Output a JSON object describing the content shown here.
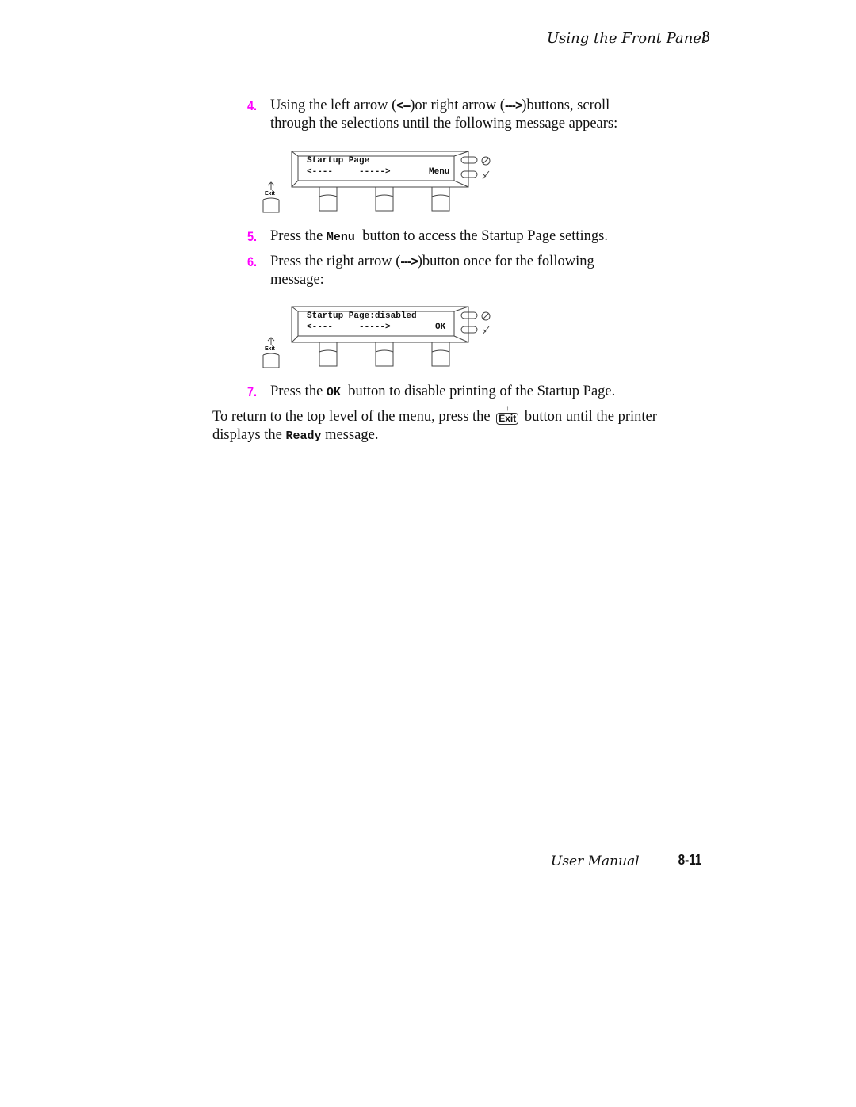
{
  "header": {
    "section_title": "Using the Front Panel",
    "chapter_number": "8"
  },
  "steps": [
    {
      "number": "4.",
      "parts": {
        "a": "Using the left arrow (",
        "left_arrow": "<--",
        "b": ")or right arrow (",
        "right_arrow": "--->",
        "c": ")buttons, scroll",
        "line2": "through the selections until the following message appears:"
      }
    },
    {
      "number": "5.",
      "parts": {
        "a": "Press the ",
        "key": "Menu",
        "b": "  button to access the Startup Page settings."
      }
    },
    {
      "number": "6.",
      "parts": {
        "a": "Press the right arrow (",
        "right_arrow": "--->",
        "b": ")button once for the following",
        "line2": "message:"
      }
    },
    {
      "number": "7.",
      "parts": {
        "a": "Press the ",
        "key": "OK",
        "b": "  button to disable printing of the Startup Page."
      }
    }
  ],
  "panels": [
    {
      "line1": "Startup Page",
      "left_arrow": "<----",
      "right_arrow": "----->",
      "softkey": "Menu",
      "exit_label": "Exit",
      "icons": [
        "online-icon",
        "cancel-icon"
      ]
    },
    {
      "line1": "Startup Page:disabled",
      "left_arrow": "<----",
      "right_arrow": "----->",
      "softkey": "OK",
      "exit_label": "Exit",
      "icons": [
        "online-icon",
        "cancel-icon"
      ]
    }
  ],
  "closing": {
    "a": "To return to the top level of the menu, press the ",
    "exit_key": "Exit",
    "b": " button until the printer",
    "c": "displays the ",
    "ready": "Ready",
    "d": " message."
  },
  "footer": {
    "manual_title": "User Manual",
    "page_number": "8-11"
  },
  "colors": {
    "step_number": "#ff00ff",
    "text": "#111111"
  }
}
